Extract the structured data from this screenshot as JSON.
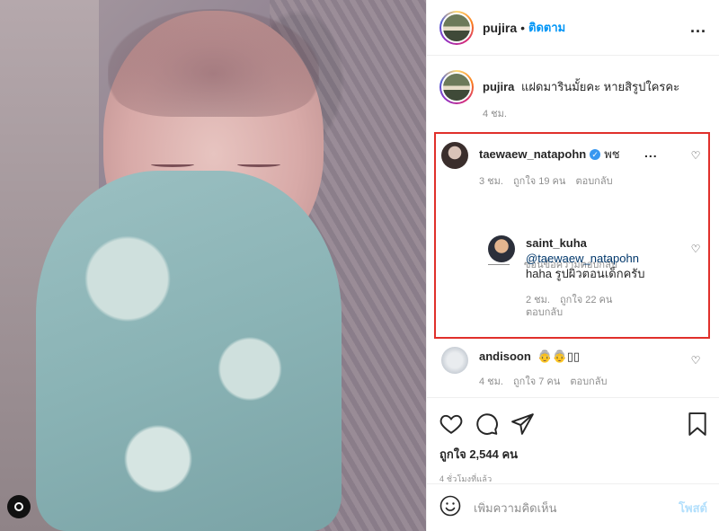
{
  "post": {
    "username": "pujira",
    "separator": "•",
    "follow_label": "ติดตาม",
    "more": "..."
  },
  "caption": {
    "username": "pujira",
    "text": "แฝดมารินมั้ยคะ หายสิรูปใครคะ",
    "time": "4 ชม."
  },
  "comments": [
    {
      "username": "taewaew_natapohn",
      "verified": true,
      "text": "พช",
      "time": "3 ชม.",
      "likes": "ถูกใจ 19 คน",
      "reply": "ตอบกลับ",
      "more": "..."
    },
    {
      "username": "saint_kuha",
      "mention": "@taewaew_natapohn",
      "text": "haha รูปผิวตอนเด็กครับ",
      "time": "2 ชม.",
      "likes": "ถูกใจ 22 คน",
      "reply": "ตอบกลับ"
    },
    {
      "username": "andisoon",
      "text": "👵👵▯▯",
      "time": "4 ชม.",
      "likes": "ถูกใจ 7 คน",
      "reply": "ตอบกลับ"
    }
  ],
  "hide_replies": "ซ่อนข้อความตอบกลับ",
  "likes_total": "ถูกใจ 2,544 คน",
  "posted_ago": "4 ชั่วโมงที่แล้ว",
  "add_comment": {
    "placeholder": "เพิ่มความคิดเห็น",
    "post_label": "โพสต์"
  },
  "colors": {
    "follow": "#0095f6",
    "highlight": "#e0302b",
    "verified": "#3897f0",
    "post_disabled": "#b2dffc"
  }
}
